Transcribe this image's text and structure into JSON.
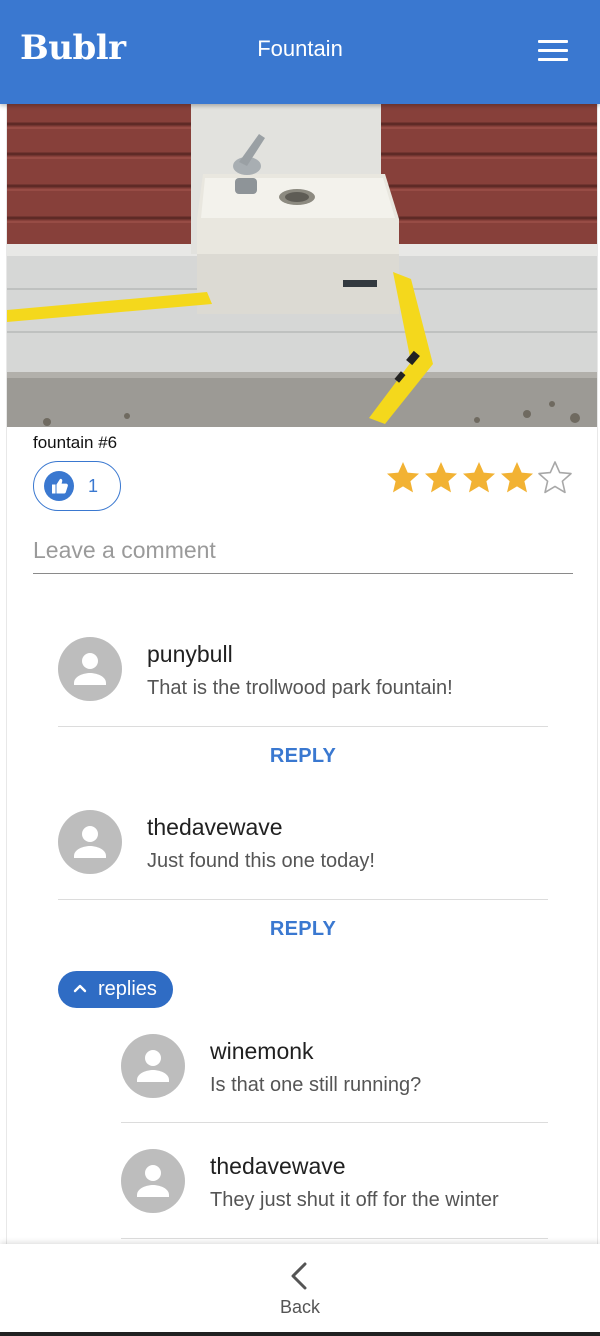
{
  "app": {
    "logo": "Bublr",
    "title": "Fountain"
  },
  "header": {
    "menu_icon": "hamburger-menu-icon"
  },
  "colors": {
    "primary": "#3a78d0",
    "chip": "#2f6cc4",
    "star_filled": "#f2b233",
    "star_empty": "#a8a8a8",
    "avatar": "#bdbdbd"
  },
  "post": {
    "caption": "fountain #6",
    "likes": "1",
    "like_icon": "thumbs-up-icon",
    "rating": {
      "value": 4,
      "max": 5
    }
  },
  "comment_box": {
    "placeholder": "Leave a comment",
    "value": ""
  },
  "comments": [
    {
      "user": "punybull",
      "text": "That is the trollwood park fountain!",
      "reply_label": "REPLY"
    },
    {
      "user": "thedavewave",
      "text": "Just found this one today!",
      "reply_label": "REPLY"
    }
  ],
  "replies_toggle": {
    "label": "replies",
    "icon": "chevron-up-icon"
  },
  "replies": [
    {
      "user": "winemonk",
      "text": "Is that one still running?"
    },
    {
      "user": "thedavewave",
      "text": "They just shut it off for the winter"
    }
  ],
  "bottom_nav": {
    "back_label": "Back",
    "back_icon": "chevron-left-icon"
  }
}
